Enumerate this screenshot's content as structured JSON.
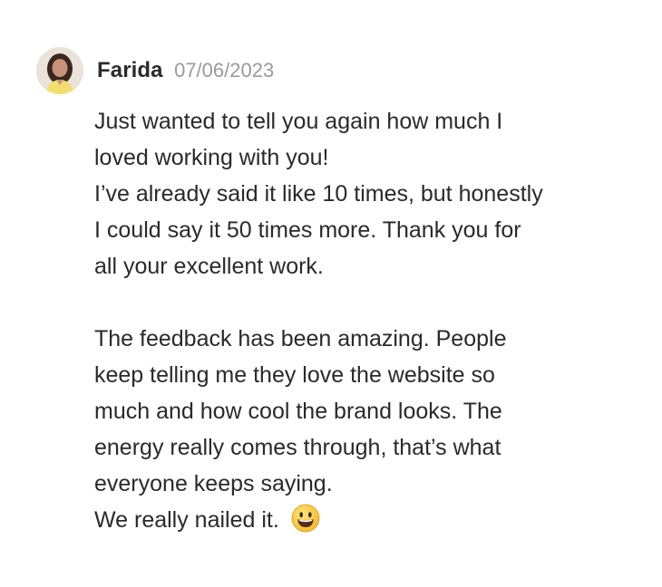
{
  "message": {
    "author": "Farida",
    "timestamp": "07/06/2023",
    "lines": [
      "Just wanted to tell you again how much I",
      "loved working with you!",
      "I’ve already said it like 10 times, but honestly",
      "I could say it 50 times more. Thank you for",
      "all your excellent work.",
      "The feedback has been amazing. People",
      "keep telling me they love the website so",
      "much and how cool the brand looks. The",
      "energy really comes through, that’s what",
      "everyone keeps saying.",
      "We really nailed it."
    ],
    "emoji": "grinning-face-emoji"
  },
  "colors": {
    "author": "#2b2b2b",
    "timestamp": "#9a9a9a",
    "text": "#2a2a2a",
    "emoji_face": "#f7c83e"
  }
}
